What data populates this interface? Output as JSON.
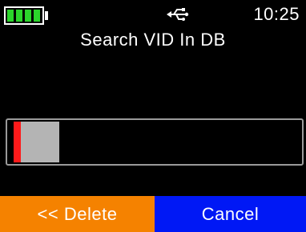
{
  "status_bar": {
    "battery": {
      "level_cells": 4,
      "color": "#2bd52b"
    },
    "usb_icon": "usb-icon",
    "time": "10:25"
  },
  "screen": {
    "title": "Search VID In DB"
  },
  "progress": {
    "marker_color": "#ff1a1a",
    "fill_color": "#b4b4b4"
  },
  "softkeys": {
    "left_label": "<< Delete",
    "left_color": "#f58200",
    "right_label": "Cancel",
    "right_color": "#0018f5"
  }
}
